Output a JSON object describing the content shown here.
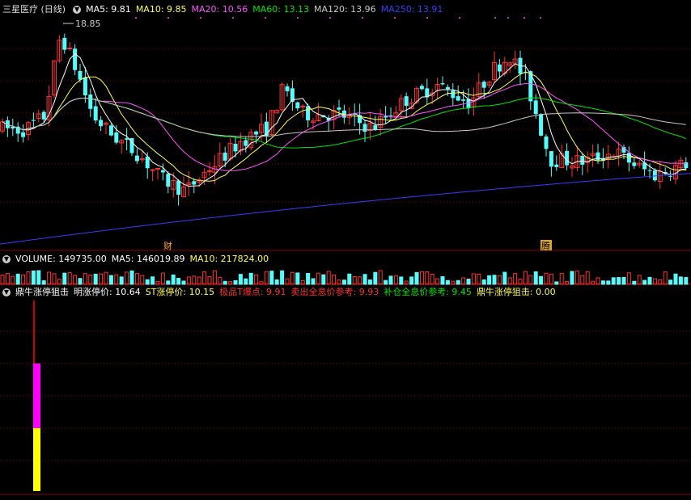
{
  "colors": {
    "up": "#ff3232",
    "down": "#54fcfc",
    "ma5": "#ffffff",
    "ma10": "#ffff54",
    "ma20": "#ff54ff",
    "ma60": "#00e600",
    "ma120": "#c8c8c8",
    "ma250": "#3c3cff",
    "grid": "#8b0000"
  },
  "header": {
    "title": "三星医疗 (日线)",
    "ma5": "MA5: 9.81",
    "ma10": "MA10: 9.85",
    "ma20": "MA20: 10.56",
    "ma60": "MA60: 13.13",
    "ma120": "MA120: 13.96",
    "ma250": "MA250: 13.91",
    "high_label": "18.85"
  },
  "events": {
    "cai": "财",
    "teng": "腾"
  },
  "volume": {
    "label": "VOLUME: 149735.00",
    "ma5": "MA5: 146019.89",
    "ma10": "MA10: 217824.00"
  },
  "indicator": {
    "name": "鼎牛涨停狙击",
    "ming": "明涨停价: 10.64",
    "st": "ST涨停价: 10.15",
    "jipin": "极品T爆点: 9.91",
    "sell": "卖出全息价参考: 9.93",
    "buy": "补仓全息价参考: 9.45",
    "snipe": "鼎牛涨停狙击: 0.00"
  },
  "chart_data": {
    "type": "candlestick",
    "ylim": [
      7.5,
      19.3
    ],
    "annotated_high": 18.85,
    "ma250_range": [
      7.7,
      11.3
    ],
    "indicator_bar": {
      "segments": [
        "#ffff00",
        "#ff00ff",
        "#cc0000"
      ]
    }
  }
}
